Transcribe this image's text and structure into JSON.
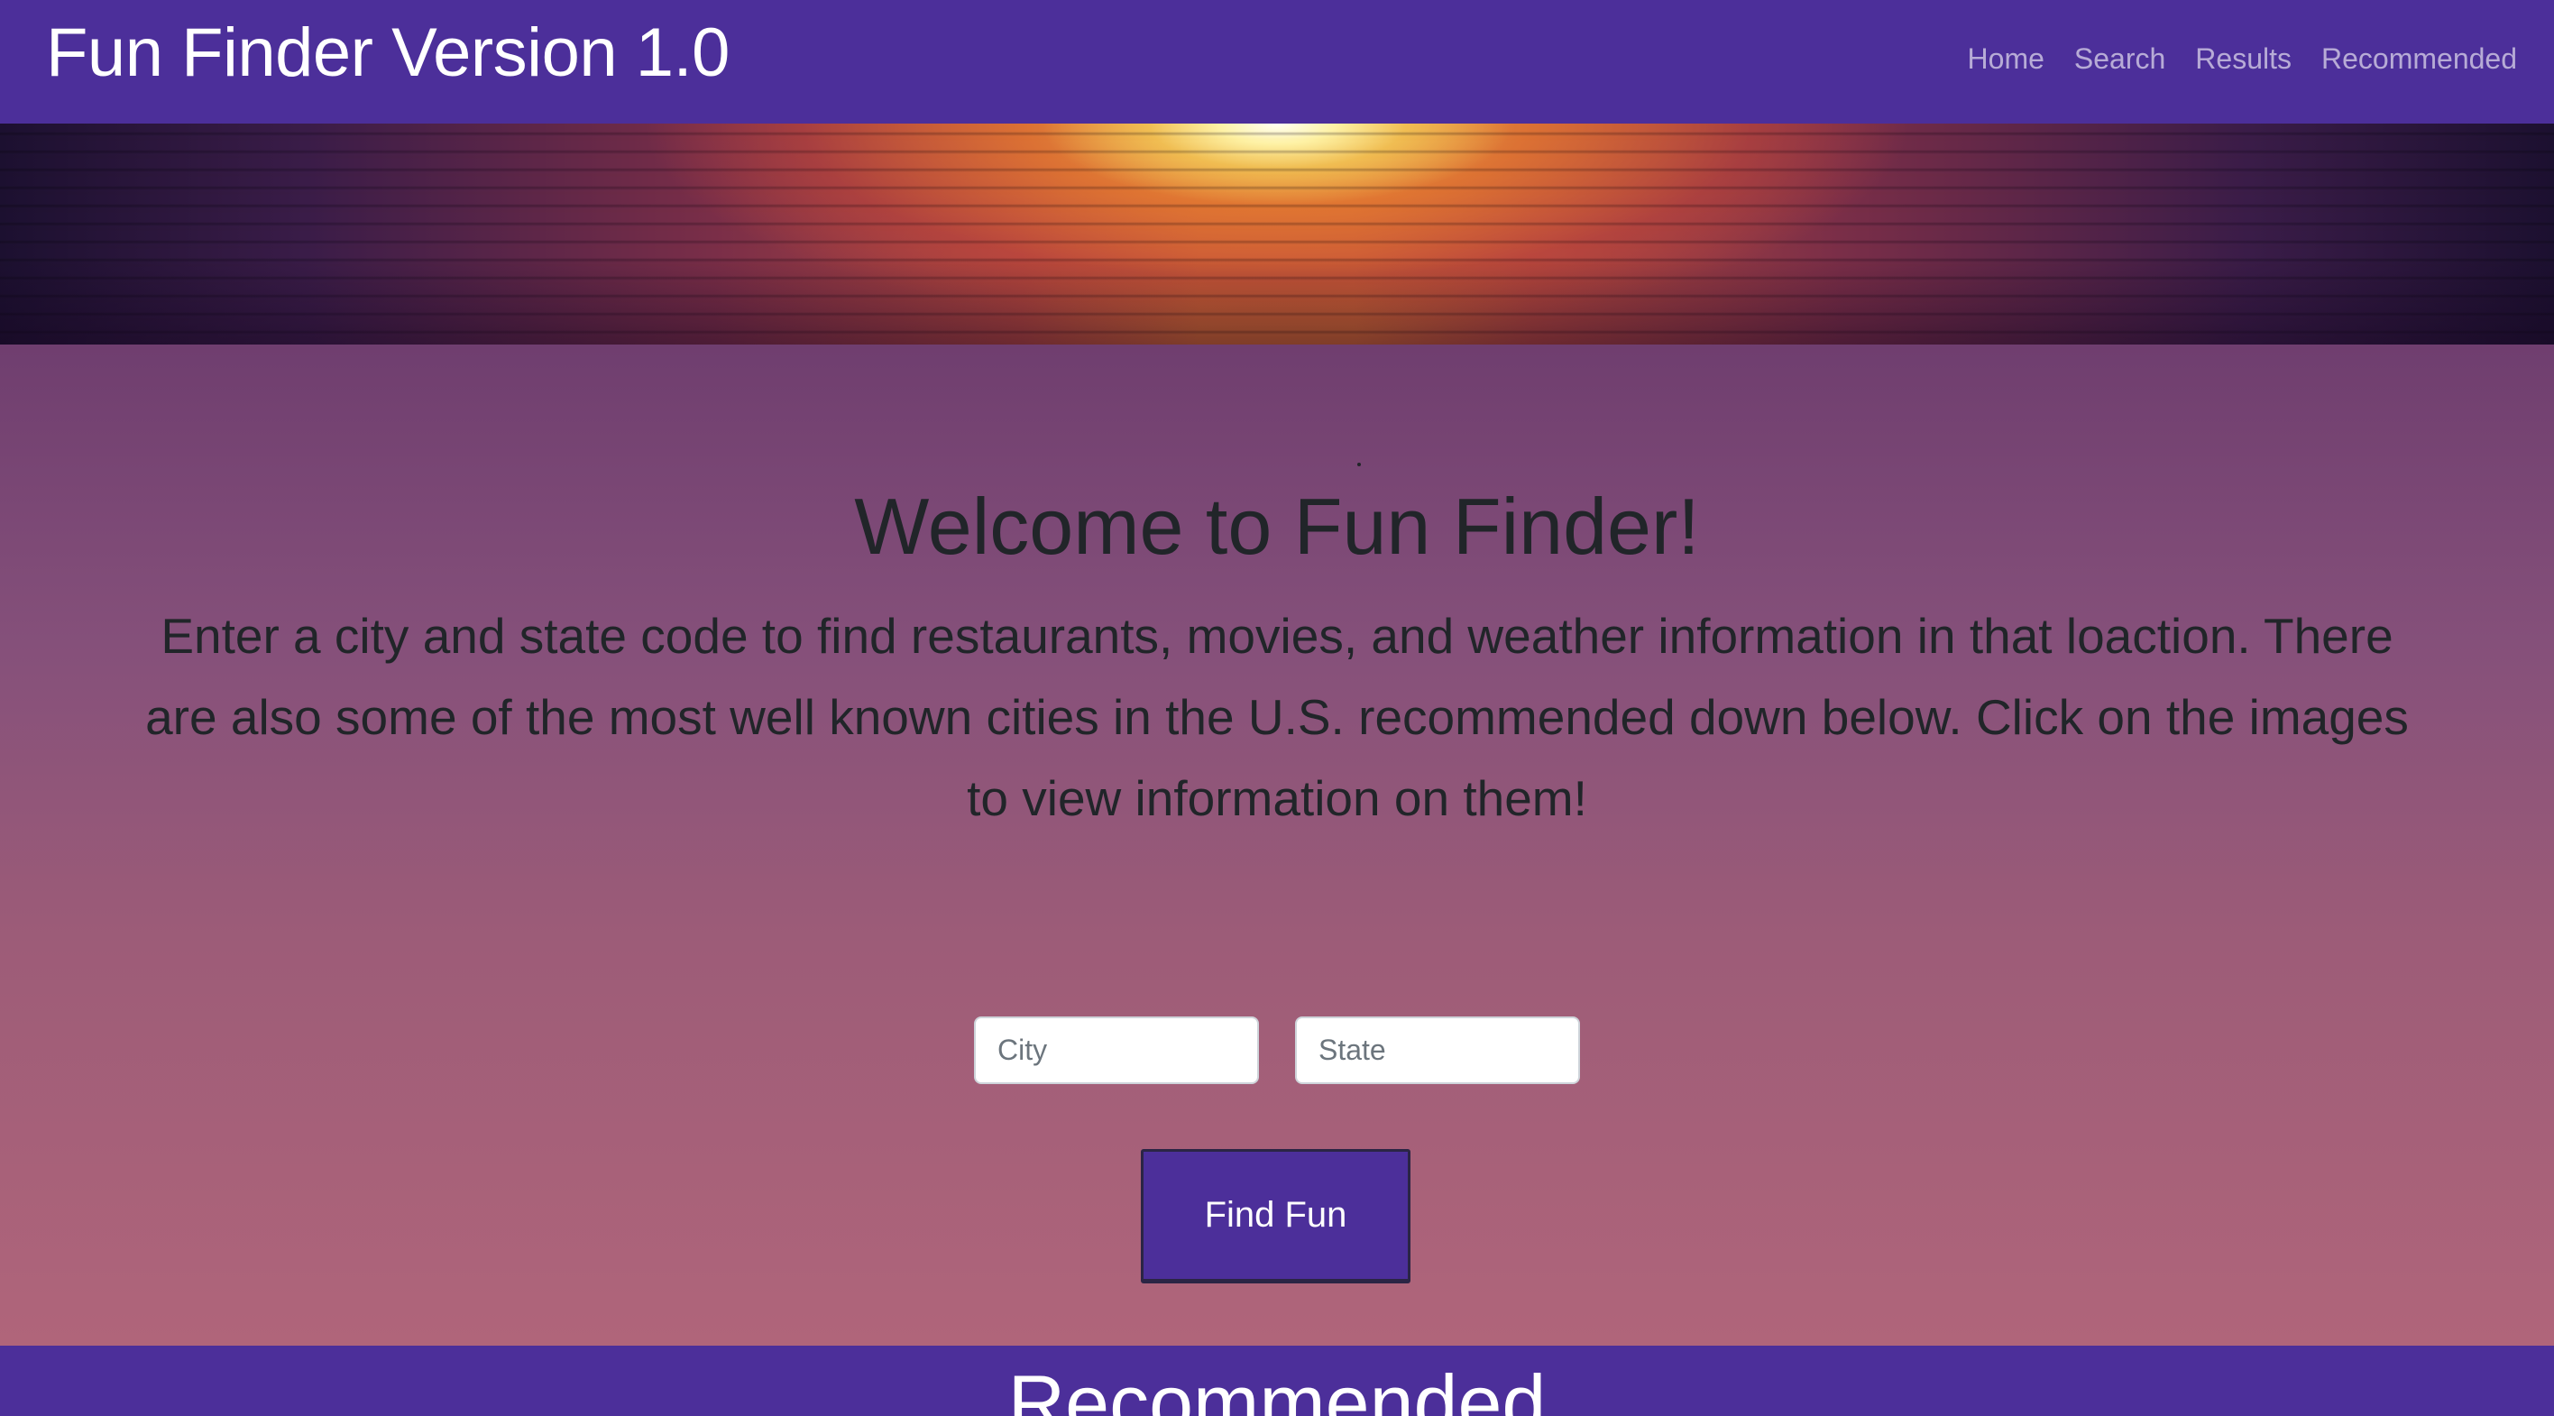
{
  "navbar": {
    "brand": "Fun Finder Version 1.0",
    "links": [
      {
        "label": "Home"
      },
      {
        "label": "Search"
      },
      {
        "label": "Results"
      },
      {
        "label": "Recommended"
      }
    ]
  },
  "banner": {
    "image": "sunset-over-water"
  },
  "hero": {
    "title": "Welcome to Fun Finder!",
    "description": "Enter a city and state code to find restaurants, movies, and weather information in that loaction. There are also some of the most well known cities in the U.S. recommended down below. Click on the images to view information on them!"
  },
  "search": {
    "city_placeholder": "City",
    "state_placeholder": "State",
    "button_label": "Find Fun"
  },
  "recommended": {
    "title": "Recommended"
  },
  "colors": {
    "navbar": "#4c2f9a",
    "hero_top": "#6f3e6f",
    "hero_bottom": "#b0657a",
    "text_dark": "#212529"
  }
}
